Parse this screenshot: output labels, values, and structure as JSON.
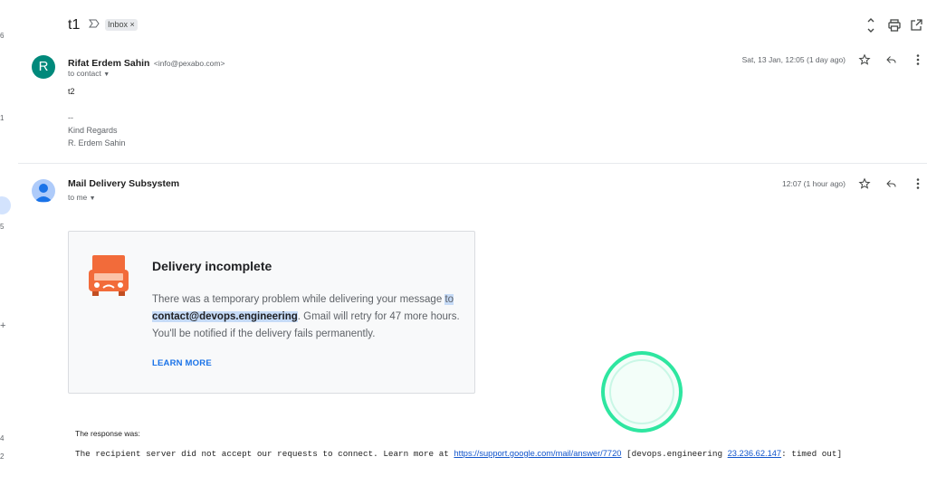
{
  "gutter": {
    "numbers": [
      "6",
      "1",
      "5",
      "4",
      "2"
    ],
    "plus": "+"
  },
  "header": {
    "subject": "t1",
    "label_chip": "Inbox ×",
    "icons": [
      "important-marker-icon",
      "expand-collapse-icon",
      "print-icon",
      "open-in-new-window-icon"
    ]
  },
  "messages": [
    {
      "avatar_letter": "R",
      "sender_name": "Rifat Erdem Sahin",
      "sender_email": "<info@pexabo.com>",
      "recipients": "to contact",
      "date": "Sat, 13 Jan, 12:05 (1 day ago)",
      "body": "t2",
      "signature": [
        "--",
        "Kind Regards",
        "R. Erdem Sahin"
      ]
    },
    {
      "sender_name": "Mail Delivery Subsystem",
      "recipients": "to me",
      "date": "12:07 (1 hour ago)",
      "card": {
        "title": "Delivery incomplete",
        "msg_part1": "There was a temporary problem while delivering your message",
        "msg_to": "to ",
        "address": "contact@devops.engineering",
        "msg_part2": ". Gmail will retry for 47 more hours. You'll be notified if the delivery fails permanently.",
        "learn_more": "LEARN MORE"
      },
      "response_title": "The response was:",
      "response_text1": "The recipient server did not accept our requests to connect. Learn more at ",
      "response_link": "https://support.google.com/mail/answer/7720",
      "response_text2": " [devops.engineering ",
      "response_ip": "23.236.62.147",
      "response_text3": ": timed out]"
    }
  ],
  "colors": {
    "avatar_r": "#00897b",
    "link": "#1155cc",
    "accent_ring": "#2ee6a0",
    "highlight": "#c6dbf7",
    "truck": "#f26b3a"
  }
}
